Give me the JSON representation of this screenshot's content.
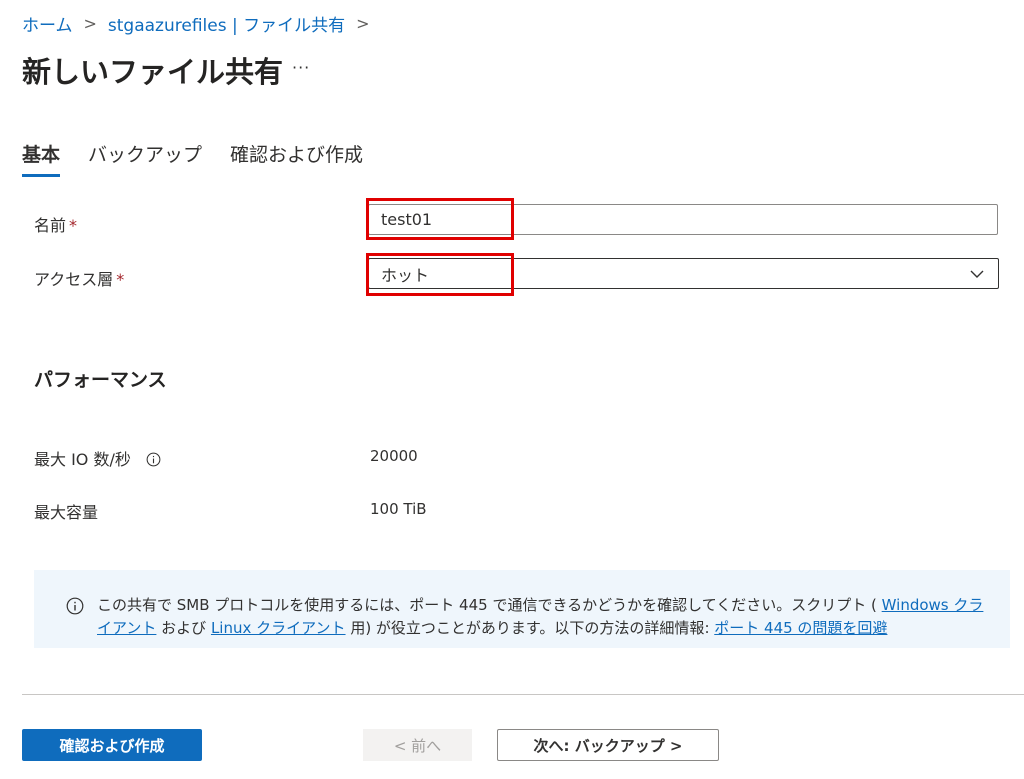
{
  "breadcrumb": {
    "items": [
      "ホーム",
      "stgaazurefiles | ファイル共有"
    ],
    "separator": ">"
  },
  "page": {
    "title": "新しいファイル共有",
    "more_label": "···"
  },
  "tabs": [
    {
      "label": "基本",
      "active": true
    },
    {
      "label": "バックアップ",
      "active": false
    },
    {
      "label": "確認および作成",
      "active": false
    }
  ],
  "form": {
    "name_label": "名前",
    "name_value": "test01",
    "access_tier_label": "アクセス層",
    "access_tier_value": "ホット",
    "required_mark": "*"
  },
  "performance": {
    "title": "パフォーマンス",
    "max_iops_label": "最大 IO 数/秒",
    "max_iops_value": "20000",
    "max_capacity_label": "最大容量",
    "max_capacity_value": "100 TiB"
  },
  "banner": {
    "text_1": "この共有で SMB プロトコルを使用するには、ポート 445 で通信できるかどうかを確認してください。スクリプト ( ",
    "link_windows": "Windows クライアント",
    "text_2": " および ",
    "link_linux": "Linux クライアント",
    "text_3": " 用) が役立つことがあります。以下の方法の詳細情報: ",
    "link_port": "ポート 445 の問題を回避"
  },
  "footer": {
    "review_create_label": "確認および作成",
    "prev_label": "< 前へ",
    "next_label": "次へ: バックアップ >"
  },
  "colors": {
    "accent": "#0f6cbd",
    "highlight": "#e00000",
    "banner_bg": "#eff6fc"
  }
}
